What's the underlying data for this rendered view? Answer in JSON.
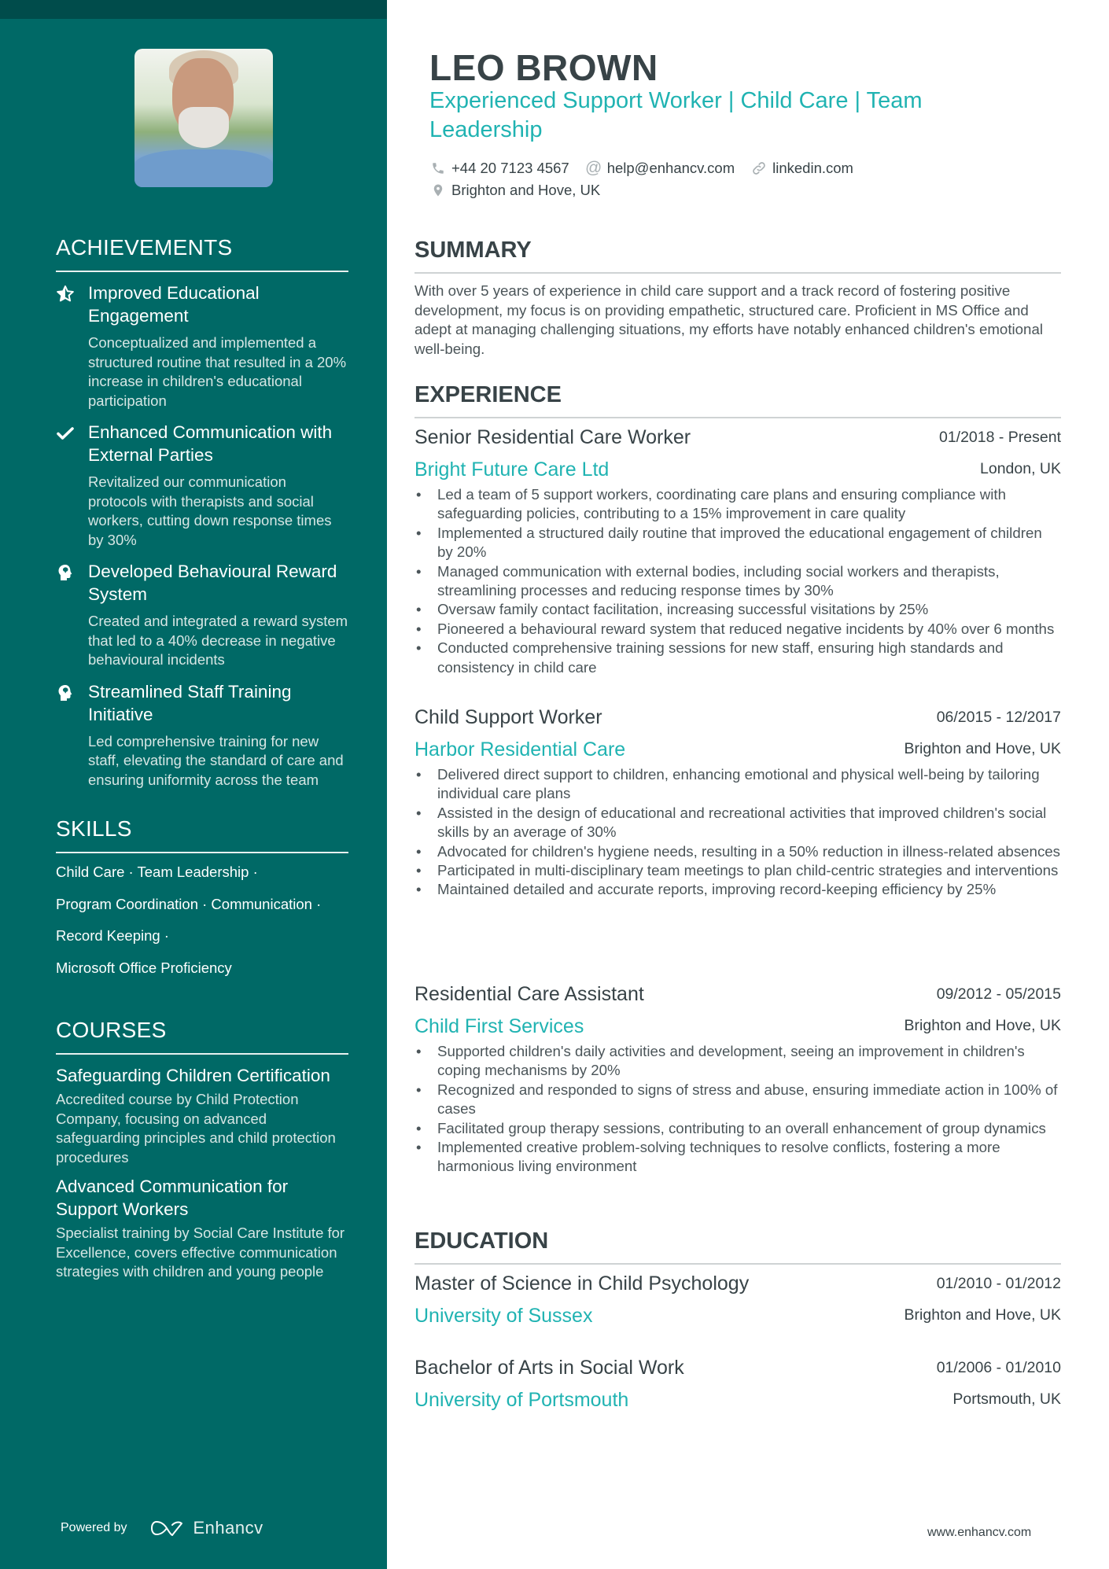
{
  "sidebar": {
    "photo_alt": "Profile photo of Leo Brown",
    "achievements": {
      "heading": "ACHIEVEMENTS",
      "items": [
        {
          "icon": "star-half-icon",
          "title": "Improved Educational Engagement",
          "desc": "Conceptualized and implemented a structured routine that resulted in a 20% increase in children's educational participation"
        },
        {
          "icon": "checkmark-icon",
          "title": "Enhanced Communication with External Parties",
          "desc": "Revitalized our communication protocols with therapists and social workers, cutting down response times by 30%"
        },
        {
          "icon": "head-brain-icon",
          "title": "Developed Behavioural Reward System",
          "desc": "Created and integrated a reward system that led to a 40% decrease in negative behavioural incidents"
        },
        {
          "icon": "head-brain-icon",
          "title": "Streamlined Staff Training Initiative",
          "desc": "Led comprehensive training for new staff, elevating the standard of care and ensuring uniformity across the team"
        }
      ]
    },
    "skills": {
      "heading": "SKILLS",
      "lines": [
        "Child Care · Team Leadership ·",
        "Program Coordination · Communication ·",
        "Record Keeping ·",
        "Microsoft Office Proficiency"
      ]
    },
    "courses": {
      "heading": "COURSES",
      "items": [
        {
          "title": "Safeguarding Children Certification",
          "desc": "Accredited course by Child Protection Company, focusing on advanced safeguarding principles and child protection procedures"
        },
        {
          "title": "Advanced Communication for Support Workers",
          "desc": "Specialist training by Social Care Institute for Excellence, covers effective communication strategies with children and young people"
        }
      ]
    },
    "footer": {
      "powered_by": "Powered by",
      "brand": "Enhancv"
    }
  },
  "header": {
    "name": "LEO BROWN",
    "headline": "Experienced Support Worker | Child Care | Team Leadership",
    "phone": "+44 20 7123 4567",
    "email": "help@enhancv.com",
    "link": "linkedin.com",
    "location": "Brighton and Hove, UK"
  },
  "summary": {
    "heading": "SUMMARY",
    "text": "With over 5 years of experience in child care support and a track record of fostering positive development, my focus is on providing empathetic, structured care. Proficient in MS Office and adept at managing challenging situations, my efforts have notably enhanced children's emotional well-being."
  },
  "experience": {
    "heading": "EXPERIENCE",
    "jobs": [
      {
        "role": "Senior Residential Care Worker",
        "dates": "01/2018 - Present",
        "company": "Bright Future Care Ltd",
        "location": "London, UK",
        "bullets": [
          "Led a team of 5 support workers, coordinating care plans and ensuring compliance with safeguarding policies, contributing to a 15% improvement in care quality",
          "Implemented a structured daily routine that improved the educational engagement of children by 20%",
          "Managed communication with external bodies, including social workers and therapists, streamlining processes and reducing response times by 30%",
          "Oversaw family contact facilitation, increasing successful visitations by 25%",
          "Pioneered a behavioural reward system that reduced negative incidents by 40% over 6 months",
          "Conducted comprehensive training sessions for new staff, ensuring high standards and consistency in child care"
        ]
      },
      {
        "role": "Child Support Worker",
        "dates": "06/2015 - 12/2017",
        "company": "Harbor Residential Care",
        "location": "Brighton and Hove, UK",
        "bullets": [
          "Delivered direct support to children, enhancing emotional and physical well-being by tailoring individual care plans",
          "Assisted in the design of educational and recreational activities that improved children's social skills by an average of 30%",
          "Advocated for children's hygiene needs, resulting in a 50% reduction in illness-related absences",
          "Participated in multi-disciplinary team meetings to plan child-centric strategies and interventions",
          "Maintained detailed and accurate reports, improving record-keeping efficiency by 25%"
        ]
      },
      {
        "role": "Residential Care Assistant",
        "dates": "09/2012 - 05/2015",
        "company": "Child First Services",
        "location": "Brighton and Hove, UK",
        "bullets": [
          "Supported children's daily activities and development, seeing an improvement in children's coping mechanisms by 20%",
          "Recognized and responded to signs of stress and abuse, ensuring immediate action in 100% of cases",
          "Facilitated group therapy sessions, contributing to an overall enhancement of group dynamics",
          "Implemented creative problem-solving techniques to resolve conflicts, fostering a more harmonious living environment"
        ]
      }
    ]
  },
  "education": {
    "heading": "EDUCATION",
    "items": [
      {
        "degree": "Master of Science in Child Psychology",
        "dates": "01/2010 - 01/2012",
        "school": "University of Sussex",
        "location": "Brighton and Hove, UK"
      },
      {
        "degree": "Bachelor of Arts in Social Work",
        "dates": "01/2006 - 01/2010",
        "school": "University of Portsmouth",
        "location": "Portsmouth, UK"
      }
    ]
  },
  "footer": {
    "site": "www.enhancv.com"
  },
  "colors": {
    "sidebar": "#006966",
    "sidebar_top": "#004c4b",
    "accent": "#20b3b2",
    "text": "#384347"
  }
}
